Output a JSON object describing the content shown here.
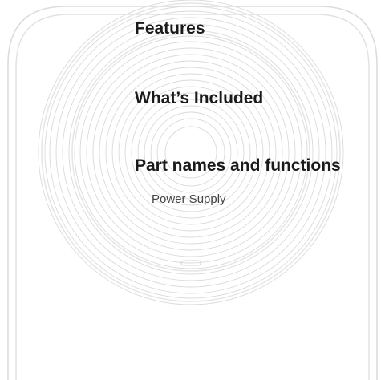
{
  "nav": {
    "features_label": "Features",
    "included_label": "What’s Included",
    "parts_label": "Part names and functions",
    "power_supply_label": "Power Supply"
  },
  "illustration": {
    "icon": "wireless-charger-pad-outline",
    "stroke_color": "#d9d9d9",
    "background_color": "#ffffff"
  }
}
